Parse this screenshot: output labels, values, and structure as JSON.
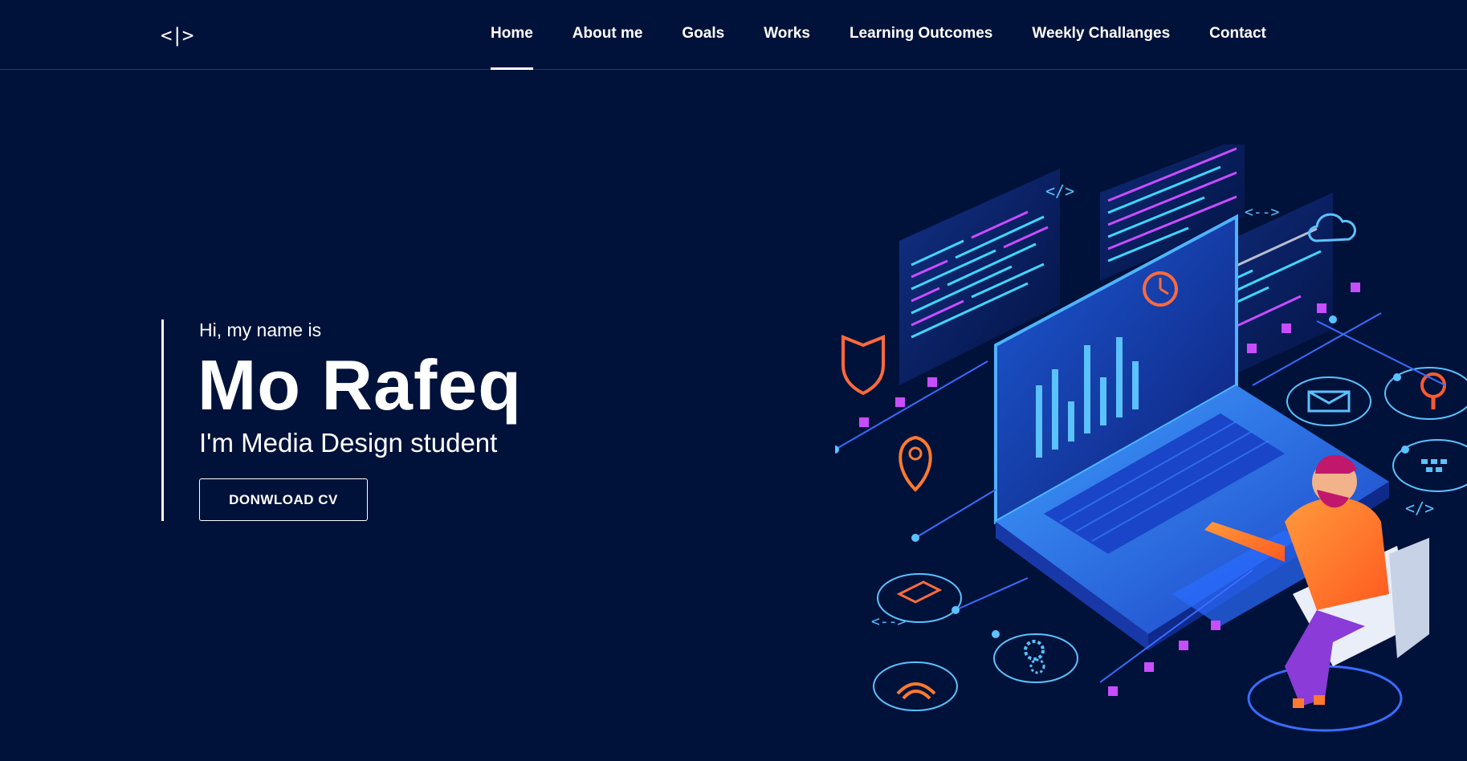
{
  "logo": {
    "text": "<|>"
  },
  "nav": {
    "items": [
      {
        "label": "Home",
        "active": true
      },
      {
        "label": "About me"
      },
      {
        "label": "Goals"
      },
      {
        "label": "Works"
      },
      {
        "label": "Learning Outcomes"
      },
      {
        "label": "Weekly Challanges"
      },
      {
        "label": "Contact"
      }
    ]
  },
  "hero": {
    "greeting": "Hi, my name is",
    "name": "Mo Rafeq",
    "role": "I'm Media Design student",
    "cv_button": "DONWLOAD CV"
  },
  "illustration": {
    "code_tags": [
      "</>",
      "<-->",
      "</>",
      "<-->"
    ]
  },
  "colors": {
    "background": "#01123a",
    "accent_blue": "#2aa8ff",
    "accent_purple": "#9b4dff",
    "accent_orange": "#ff7a2e"
  }
}
